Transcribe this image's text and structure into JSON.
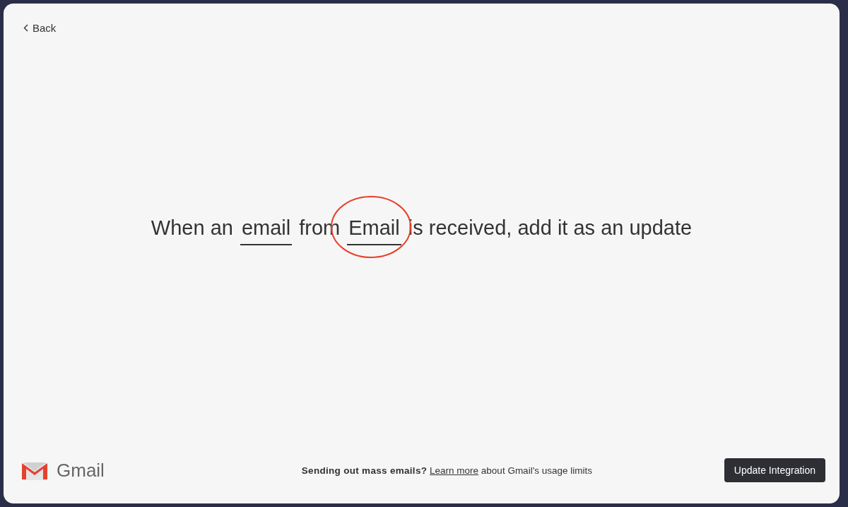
{
  "back": {
    "label": "Back"
  },
  "sentence": [
    {
      "kind": "text",
      "text": "When an"
    },
    {
      "kind": "select",
      "text": "email",
      "highlighted": false
    },
    {
      "kind": "text",
      "text": "from"
    },
    {
      "kind": "select",
      "text": "Email",
      "highlighted": true
    },
    {
      "kind": "text",
      "text": "is received, add it as an update"
    }
  ],
  "footer": {
    "brand": "Gmail",
    "notice": "**Sending out mass emails?**",
    "link": "Learn more",
    "notice_rest": "about Gmail's usage limits",
    "button": "Update Integration"
  }
}
